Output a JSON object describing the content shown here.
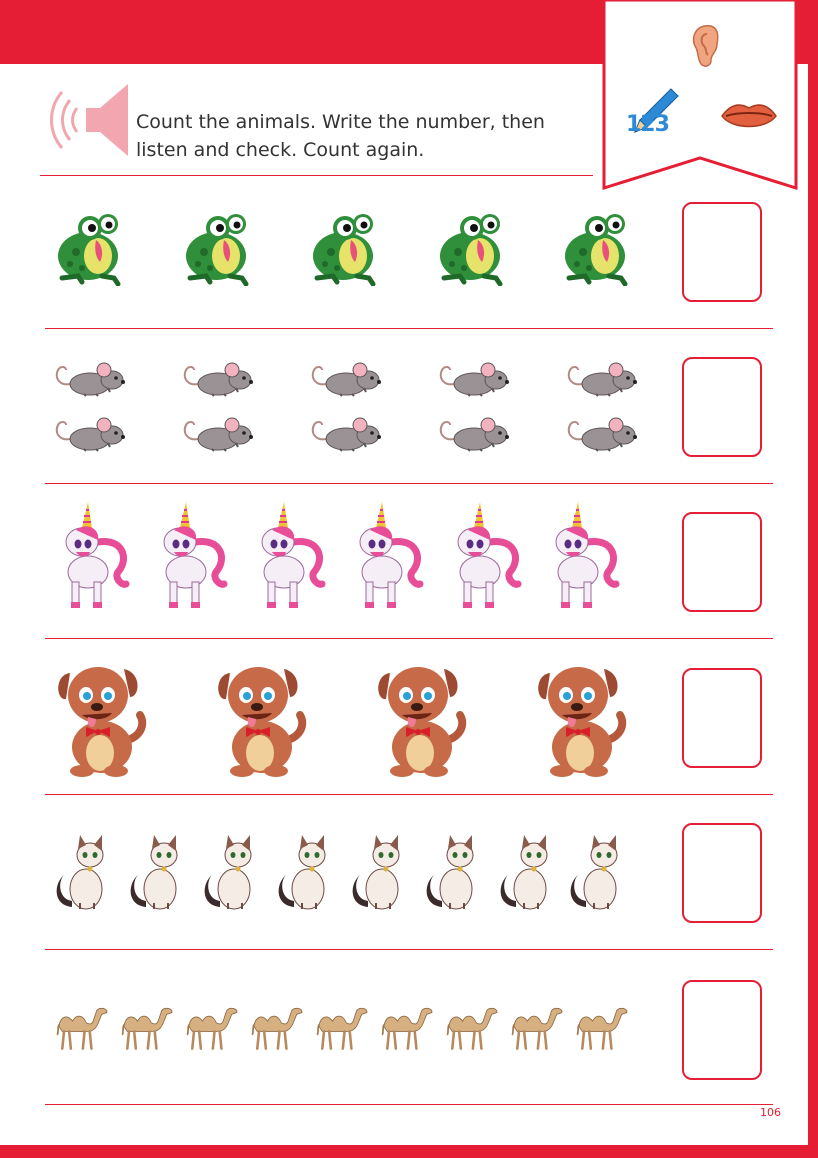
{
  "header": {
    "instruction": "Count the animals. Write the number, then listen and check. Count again.",
    "icons": [
      "speaker-icon",
      "ear-icon",
      "pencil-icon",
      "lips-icon"
    ],
    "counting_label": "123"
  },
  "rows": [
    {
      "animal": "frog-icon",
      "count_shown": 5
    },
    {
      "animal": "mouse-icon",
      "count_shown": 10
    },
    {
      "animal": "unicorn-icon",
      "count_shown": 6
    },
    {
      "animal": "dog-icon",
      "count_shown": 4
    },
    {
      "animal": "cat-icon",
      "count_shown": 8
    },
    {
      "animal": "camel-icon",
      "count_shown": 9
    }
  ],
  "answer_boxes": [
    "",
    "",
    "",
    "",
    "",
    ""
  ],
  "page_number": "106",
  "colors": {
    "accent": "#e61e35",
    "text": "#333333",
    "speaker": "#f2a7b0",
    "pencil": "#2d8ad6"
  }
}
